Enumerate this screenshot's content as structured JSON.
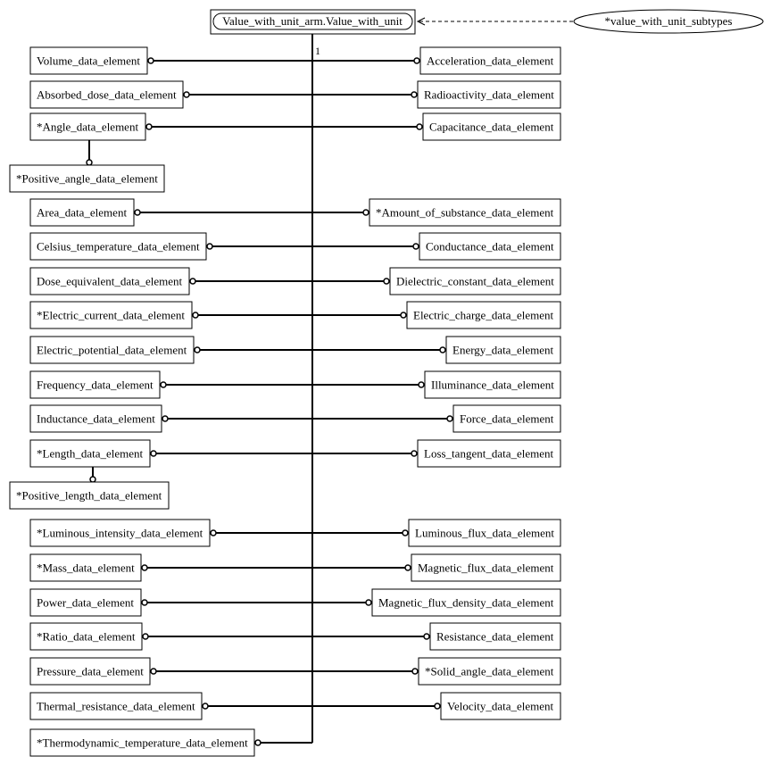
{
  "diagram": {
    "root": {
      "label": "Value_with_unit_arm.Value_with_unit"
    },
    "subtype_ellipse": {
      "label": "*value_with_unit_subtypes"
    },
    "multiplicity": "1",
    "colors": {
      "stroke": "#000000",
      "background": "#ffffff"
    },
    "rows": [
      {
        "left": "Volume_data_element",
        "right": "Acceleration_data_element"
      },
      {
        "left": "Absorbed_dose_data_element",
        "right": "Radioactivity_data_element"
      },
      {
        "left": "*Angle_data_element",
        "right": "Capacitance_data_element",
        "child": "*Positive_angle_data_element"
      },
      {
        "left": "Area_data_element",
        "right": "*Amount_of_substance_data_element"
      },
      {
        "left": "Celsius_temperature_data_element",
        "right": "Conductance_data_element"
      },
      {
        "left": "Dose_equivalent_data_element",
        "right": "Dielectric_constant_data_element"
      },
      {
        "left": "*Electric_current_data_element",
        "right": "Electric_charge_data_element"
      },
      {
        "left": "Electric_potential_data_element",
        "right": "Energy_data_element"
      },
      {
        "left": "Frequency_data_element",
        "right": "Illuminance_data_element"
      },
      {
        "left": "Inductance_data_element",
        "right": "Force_data_element"
      },
      {
        "left": "*Length_data_element",
        "right": "Loss_tangent_data_element",
        "child": "*Positive_length_data_element"
      },
      {
        "left": "*Luminous_intensity_data_element",
        "right": "Luminous_flux_data_element"
      },
      {
        "left": "*Mass_data_element",
        "right": "Magnetic_flux_data_element"
      },
      {
        "left": "Power_data_element",
        "right": "Magnetic_flux_density_data_element"
      },
      {
        "left": "*Ratio_data_element",
        "right": "Resistance_data_element"
      },
      {
        "left": "Pressure_data_element",
        "right": "*Solid_angle_data_element"
      },
      {
        "left": "Thermal_resistance_data_element",
        "right": "Velocity_data_element"
      },
      {
        "left": "*Thermodynamic_temperature_data_element"
      }
    ]
  }
}
